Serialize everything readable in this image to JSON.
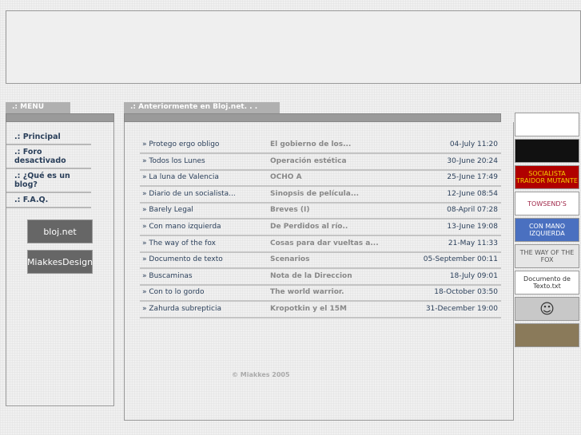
{
  "menu": {
    "title": ".: MENU",
    "items": [
      ".: Principal",
      ".: Foro desactivado",
      ".: ¿Qué es un blog?",
      ".: F.A.Q."
    ],
    "logos": [
      "bloj.net",
      "MiakkesDesign"
    ]
  },
  "main": {
    "title": ".: Anteriormente en Bloj.net. . .",
    "rows": [
      {
        "t": "Protego ergo obligo",
        "s": "El gobierno de los...",
        "d": "04-July 11:20"
      },
      {
        "t": "Todos los Lunes",
        "s": "Operación estética",
        "d": "30-June 20:24"
      },
      {
        "t": "La luna de Valencia",
        "s": "OCHO A",
        "d": "25-June 17:49"
      },
      {
        "t": "Diario de un socialista...",
        "s": "Sinopsis de película...",
        "d": "12-June 08:54"
      },
      {
        "t": "Barely Legal",
        "s": "Breves (I)",
        "d": "08-April 07:28"
      },
      {
        "t": "Con mano izquierda",
        "s": "De Perdidos al río..",
        "d": "13-June 19:08"
      },
      {
        "t": "The way of the fox",
        "s": "Cosas para dar vueltas a...",
        "d": "21-May 11:33"
      },
      {
        "t": "Documento de texto",
        "s": "Scenarios",
        "d": "05-September 00:11"
      },
      {
        "t": "Buscaminas",
        "s": "Nota de la Direccion",
        "d": "18-July 09:01"
      },
      {
        "t": "Con to lo gordo",
        "s": "The world warrior.",
        "d": "18-October 03:50"
      },
      {
        "t": "Zahurda subrepticia",
        "s": "Kropotkin y el 15M",
        "d": "31-December 19:00"
      }
    ],
    "bullet": "»",
    "footer": "© Miakkes 2005"
  },
  "side": [
    {
      "label": "",
      "bg": "#ffffff",
      "fg": "#333"
    },
    {
      "label": "",
      "bg": "#111111",
      "fg": "#ddd"
    },
    {
      "label": "SOCIALISTA TRAIDOR MUTANTE",
      "bg": "#b00000",
      "fg": "#f5d000"
    },
    {
      "label": "TOWSEND'S",
      "bg": "#ffffff",
      "fg": "#a0284a"
    },
    {
      "label": "CON MANO IZQUIERDA",
      "bg": "#4a70c0",
      "fg": "#ffffff"
    },
    {
      "label": "THE WAY OF THE FOX",
      "bg": "#e6e6e6",
      "fg": "#555"
    },
    {
      "label": "Documento de Texto.txt",
      "bg": "#ffffff",
      "fg": "#333"
    },
    {
      "label": "☺",
      "bg": "#c8c8c8",
      "fg": "#333"
    },
    {
      "label": "",
      "bg": "#8a7a5a",
      "fg": "#fff"
    }
  ]
}
